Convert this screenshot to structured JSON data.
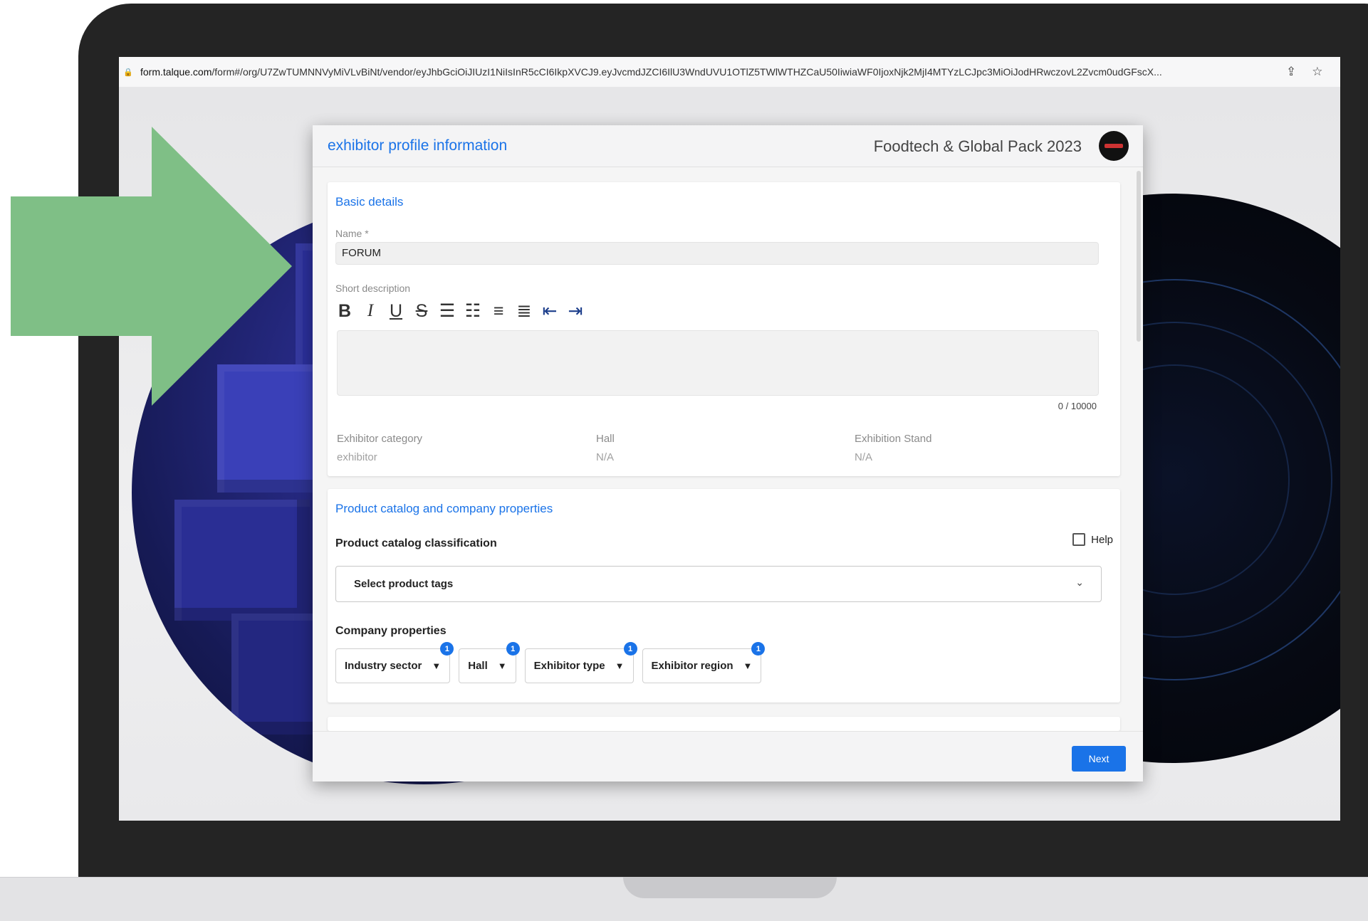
{
  "browser": {
    "url_host": "form.talque.com",
    "url_path": "/form#/org/U7ZwTUMNNVyMiVLvBiNt/vendor/eyJhbGciOiJIUzI1NiIsInR5cCI6IkpXVCJ9.eyJvcmdJZCI6IlU3WndUVU1OTlZ5TWlWTHZCaU50IiwiaWF0IjoxNjk2MjI4MTYzLCJpc3MiOiJodHRwczovL2Zvcm0udGFscX..."
  },
  "modal": {
    "title": "exhibitor profile information",
    "event_name": "Foodtech & Global Pack 2023"
  },
  "basic": {
    "section_title": "Basic details",
    "name_label": "Name *",
    "name_value": "FORUM",
    "short_desc_label": "Short description",
    "counter": "0 / 10000",
    "category_label": "Exhibitor category",
    "category_value": "exhibitor",
    "hall_label": "Hall",
    "hall_value": "N/A",
    "stand_label": "Exhibition Stand",
    "stand_value": "N/A"
  },
  "catalog": {
    "section_title": "Product catalog and company properties",
    "classification_label": "Product catalog classification",
    "help_label": "Help",
    "select_placeholder": "Select product tags",
    "company_props_label": "Company properties",
    "props": [
      {
        "label": "Industry sector",
        "badge": "1"
      },
      {
        "label": "Hall",
        "badge": "1"
      },
      {
        "label": "Exhibitor type",
        "badge": "1"
      },
      {
        "label": "Exhibitor region",
        "badge": "1"
      }
    ]
  },
  "footer": {
    "next_label": "Next"
  },
  "colors": {
    "accent": "#1a73e8",
    "arrow": "#7fbf86"
  }
}
